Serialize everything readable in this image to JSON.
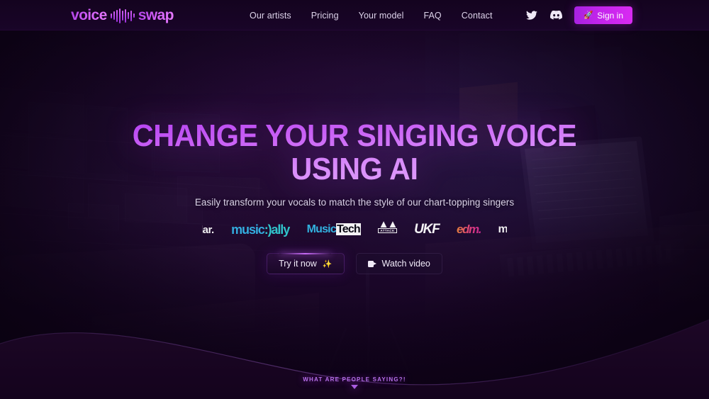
{
  "header": {
    "logo": {
      "word1": "voice",
      "word2": "swap",
      "icon": "waveform-icon"
    },
    "nav": [
      {
        "label": "Our artists"
      },
      {
        "label": "Pricing"
      },
      {
        "label": "Your model"
      },
      {
        "label": "FAQ"
      },
      {
        "label": "Contact"
      }
    ],
    "social": [
      {
        "name": "twitter-icon",
        "glyph": "twitter"
      },
      {
        "name": "discord-icon",
        "glyph": "discord"
      }
    ],
    "signin": {
      "label": "Sign in",
      "icon": "rocket-icon",
      "icon_glyph": "🚀"
    }
  },
  "hero": {
    "headline_line1": "CHANGE YOUR SINGING VOICE",
    "headline_line2": "USING AI",
    "subtitle": "Easily transform your vocals to match the style of our chart-topping singers",
    "press_logos": [
      {
        "name": "radar-logo",
        "text": "dar."
      },
      {
        "name": "music-ally-logo",
        "text": "music:)ally"
      },
      {
        "name": "musictech-logo",
        "text": "MusicTech"
      },
      {
        "name": "attack-magazine-logo",
        "text": "ATTACK"
      },
      {
        "name": "ukf-logo",
        "text": "UKF"
      },
      {
        "name": "edm-logo",
        "text": "edm."
      },
      {
        "name": "mu-logo",
        "text": "mu"
      }
    ],
    "cta_primary": {
      "label": "Try it now",
      "icon": "sparkles-icon",
      "icon_glyph": "✨"
    },
    "cta_secondary": {
      "label": "Watch video",
      "icon": "video-camera-icon"
    }
  },
  "bottom": {
    "label": "WHAT ARE PEOPLE SAYING?!",
    "arrow": "chevron-down-icon"
  },
  "colors": {
    "accent_magenta": "#c424ec",
    "accent_purple": "#b43ff0",
    "background_dark": "#11031a",
    "header_bg": "#190528",
    "text_light": "#d9d2e6"
  }
}
